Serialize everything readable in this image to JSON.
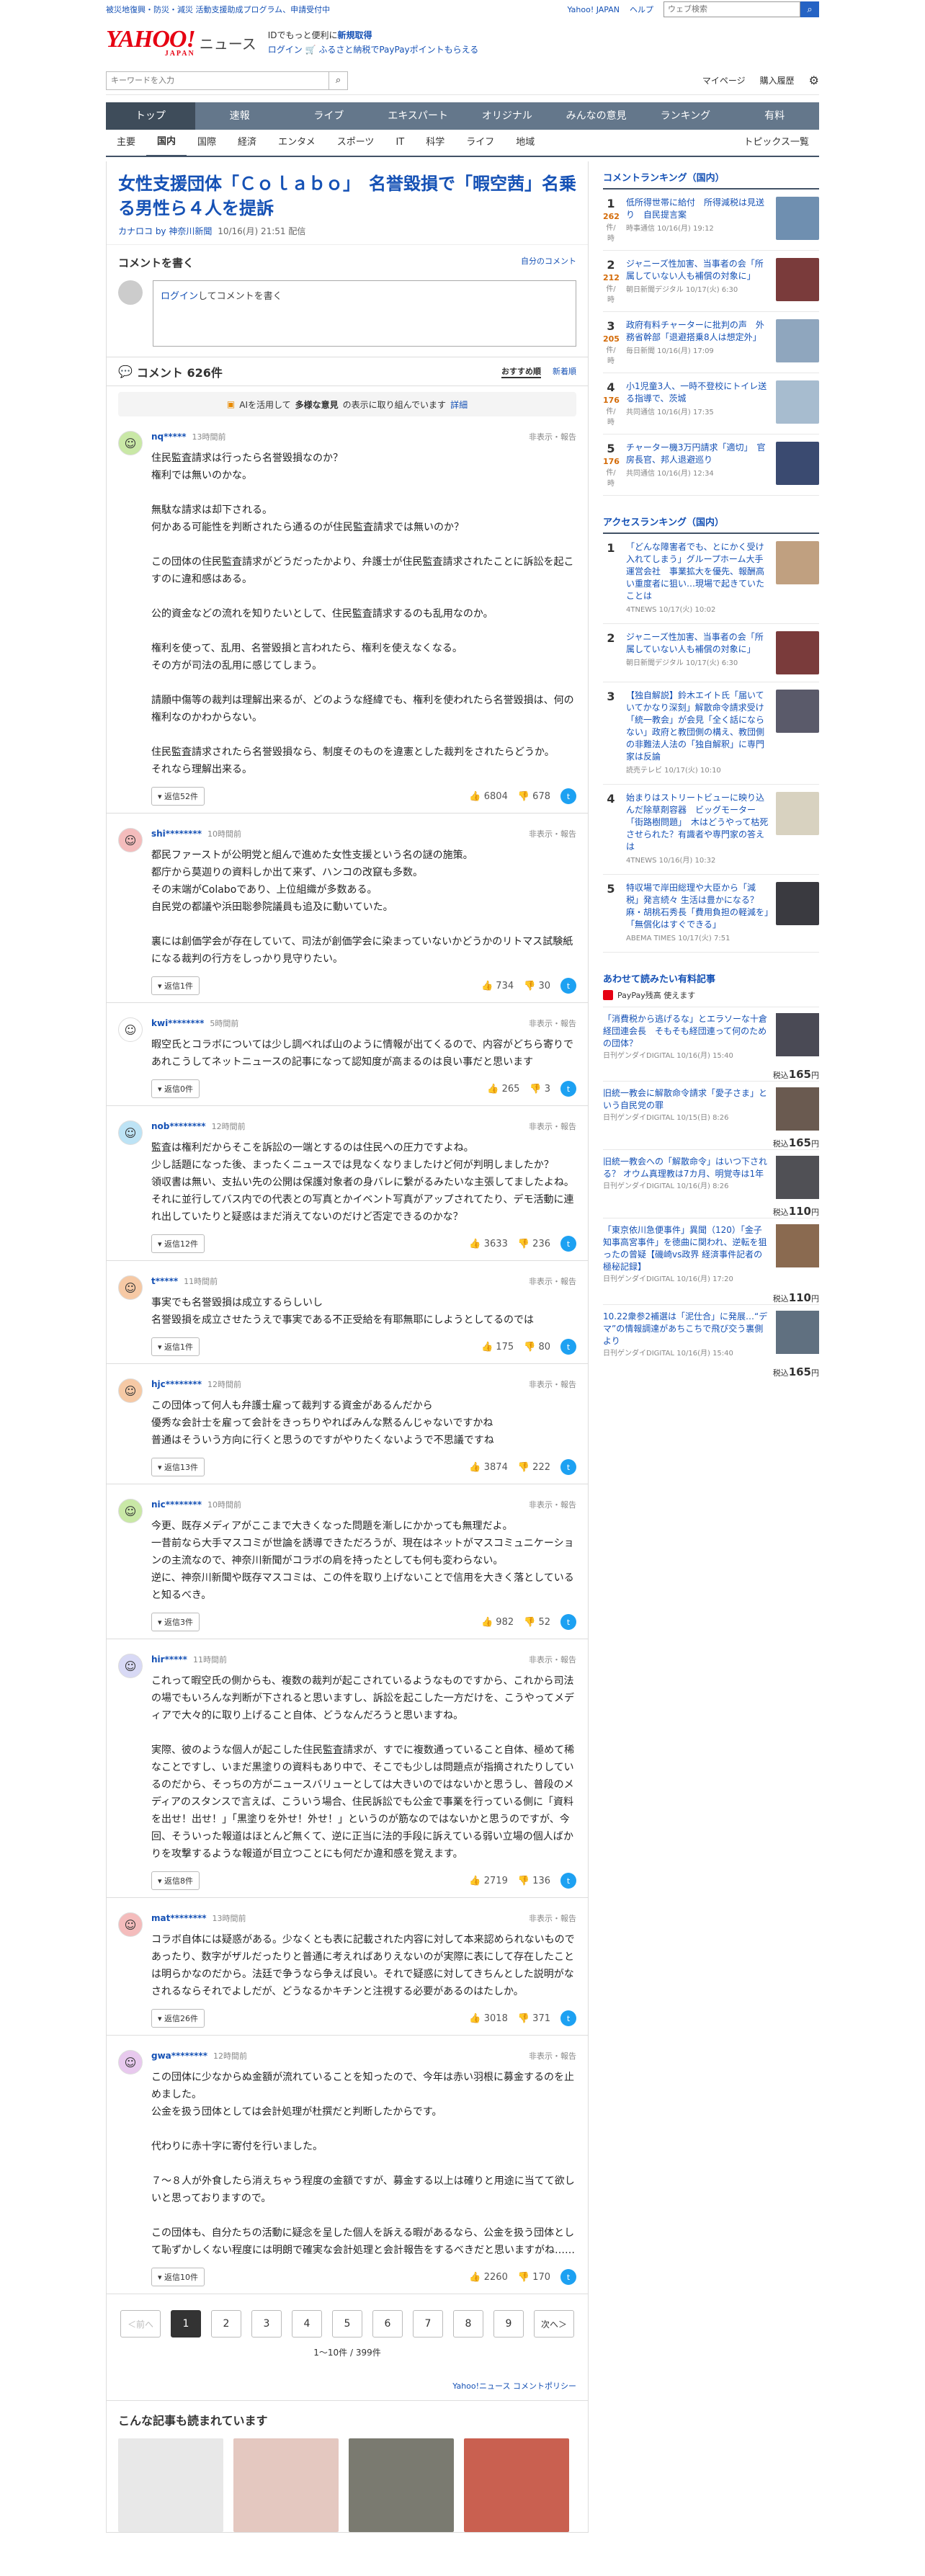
{
  "promo": {
    "text": "被災地復興・防災・減災 活動支援助成プログラム、申請受付中",
    "links": [
      "Yahoo! JAPAN",
      "ヘルプ"
    ],
    "search_placeholder": "ウェブ検索"
  },
  "brand": {
    "logo": "YAHOO!",
    "logo_sub": "JAPAN",
    "section": "ニュース",
    "msg1a": "IDでもっと便利に",
    "msg1b": "新規取得",
    "msg2a": "ログイン",
    "msg2b": "ふるさと納税でPayPayポイントもらえる"
  },
  "tools": {
    "search_placeholder": "キーワードを入力",
    "mypage": "マイページ",
    "purchase": "購入履歴"
  },
  "gnav": [
    "トップ",
    "速報",
    "ライブ",
    "エキスパート",
    "オリジナル",
    "みんなの意見",
    "ランキング",
    "有料"
  ],
  "subnav": [
    "主要",
    "国内",
    "国際",
    "経済",
    "エンタメ",
    "スポーツ",
    "IT",
    "科学",
    "ライフ",
    "地域"
  ],
  "subnav_right": "トピックス一覧",
  "article": {
    "title": "女性支援団体「Ｃｏｌａｂｏ」　名誉毀損で「暇空茜」名乗る男性ら４人を提訴",
    "author": "カナロコ by 神奈川新聞",
    "date": "10/16(月) 21:51 配信"
  },
  "comment_write": {
    "title": "コメントを書く",
    "link": "自分のコメント",
    "login": "ログイン",
    "rest": "してコメントを書く"
  },
  "comments_header": {
    "count": "コメント 626件",
    "sort_rec": "おすすめ順",
    "sort_new": "新着順"
  },
  "ai_bar": {
    "pre": "AIを活用して",
    "bold": "多様な意見",
    "post": "の表示に取り組んでいます",
    "link": "詳細"
  },
  "comments": [
    {
      "user": "nq*****",
      "time": "13時間前",
      "report": "非表示・報告",
      "text": "住民監査請求は行ったら名誉毀損なのか？\n権利では無いのかな。\n\n無駄な請求は却下される。\n何かある可能性を判断されたら通るのが住民監査請求では無いのか？\n\nこの団体の住民監査請求がどうだったかより、弁護士が住民監査請求されたことに訴訟を起こすのに違和感はある。\n\n公的資金などの流れを知りたいとして、住民監査請求するのも乱用なのか。\n\n権利を使って、乱用、名誉毀損と言われたら、権利を使えなくなる。\nその方が司法の乱用に感じてしまう。\n\n請願中傷等の裁判は理解出来るが、どのような経緯でも、権利を使われたら名誉毀損は、何の権利なのかわからない。\n\n住民監査請求されたら名誉毀損なら、制度そのものを違憲とした裁判をされたらどうか。\nそれなら理解出来る。",
      "reply": "返信52件",
      "up": "6804",
      "down": "678",
      "color": "#c9e8a6"
    },
    {
      "user": "shi********",
      "time": "10時間前",
      "report": "非表示・報告",
      "text": "都民ファーストが公明党と組んで進めた女性支援という名の謎の施策。\n都庁から莫迦りの資料しか出て来ず、ハンコの改竄も多数。\nその末端がColaboであり、上位組織が多数ある。\n自民党の都議や浜田聡参院議員も追及に動いていた。\n\n裏には創価学会が存在していて、司法が創価学会に染まっていないかどうかのリトマス試験紙になる裁判の行方をしっかり見守りたい。",
      "reply": "返信1件",
      "up": "734",
      "down": "30",
      "color": "#f4bcbc"
    },
    {
      "user": "kwi********",
      "time": "5時間前",
      "report": "非表示・報告",
      "text": "暇空氏とコラボについては少し調べれば山のように情報が出てくるので、内容がどちら寄りであれこうしてネットニュースの記事になって認知度が高まるのは良い事だと思います",
      "reply": "返信0件",
      "up": "265",
      "down": "3",
      "color": "#ffffff"
    },
    {
      "user": "nob********",
      "time": "12時間前",
      "report": "非表示・報告",
      "text": "監査は権利だからそこを訴訟の一端とするのは住民への圧力ですよね。\n少し話題になった後、まったくニュースでは見なくなりましたけど何が判明しましたか？\n領収書は無い、支払い先の公開は保護対象者の身バレに繋がるみたいな主張してましたよね。\nそれに並行してバス内での代表との写真とかイベント写真がアップされてたり、デモ活動に連れ出していたりと疑惑はまだ消えてないのだけど否定できるのかな？",
      "reply": "返信12件",
      "up": "3633",
      "down": "236",
      "color": "#bde3f5"
    },
    {
      "user": "t*****",
      "time": "11時間前",
      "report": "非表示・報告",
      "text": "事実でも名誉毀損は成立するらしいし\n名誉毀損を成立させたうえで事実である不正受給を有耶無耶にしようとしてるのでは",
      "reply": "返信1件",
      "up": "175",
      "down": "80",
      "color": "#f6c9a5"
    },
    {
      "user": "hjc********",
      "time": "12時間前",
      "report": "非表示・報告",
      "text": "この団体って何人も弁護士雇って裁判する資金があるんだから\n優秀な会計士を雇って会計をきっちりやればみんな黙るんじゃないですかね\n普通はそういう方向に行くと思うのですがやりたくないようで不思議ですね",
      "reply": "返信13件",
      "up": "3874",
      "down": "222",
      "color": "#f6c9a5"
    },
    {
      "user": "nic********",
      "time": "10時間前",
      "report": "非表示・報告",
      "text": "今更、既存メディアがここまで大きくなった問題を漸しにかかっても無理だよ。\n一昔前なら大手マスコミが世論を誘導できただろうが、現在はネットがマスコミュニケーションの主流なので、神奈川新聞がコラボの肩を持ったとしても何も変わらない。\n逆に、神奈川新聞や既存マスコミは、この件を取り上げないことで信用を大きく落としていると知るべき。",
      "reply": "返信3件",
      "up": "982",
      "down": "52",
      "color": "#c9e8a6"
    },
    {
      "user": "hir*****",
      "time": "11時間前",
      "report": "非表示・報告",
      "text": "これって暇空氏の側からも、複数の裁判が起こされているようなものですから、これから司法の場でもいろんな判断が下されると思いますし、訴訟を起こした一方だけを、こうやってメディアで大々的に取り上げること自体、どうなんだろうと思いますね。\n\n実際、彼のような個人が起こした住民監査請求が、すでに複数通っていること自体、極めて稀なことですし、いまだ黒塗りの資料もあり中で、そこでも少しは問題点が指摘されたりしているのだから、そっちの方がニュースバリューとしては大きいのではないかと思うし、普段のメディアのスタンスで言えば、こういう場合、住民訴訟でも公金で事業を行っている側に「資料を出せ！出せ！」「黒塗りを外せ！外せ！」というのが筋なのではないかと思うのですが、今回、そういった報道はほとんど無くて、逆に正当に法的手段に訴えている弱い立場の個人ばかりを攻撃するような報道が目立つことにも何だか違和感を覚えます。",
      "reply": "返信8件",
      "up": "2719",
      "down": "136",
      "color": "#d8d9f5"
    },
    {
      "user": "mat********",
      "time": "13時間前",
      "report": "非表示・報告",
      "text": "コラボ自体には疑惑がある。少なくとも表に記載された内容に対して本来認められないものであったり、数字がザルだったりと普通に考えればありえないのが実際に表にして存在したことは明らかなのだから。法廷で争うなら争えば良い。それで疑惑に対してきちんとした説明がなされるならそれでよしだが、どうなるかキチンと注視する必要があるのはたしか。",
      "reply": "返信26件",
      "up": "3018",
      "down": "371",
      "color": "#f4bcbc"
    },
    {
      "user": "gwa********",
      "time": "12時間前",
      "report": "非表示・報告",
      "text": "この団体に少なからぬ金額が流れていることを知ったので、今年は赤い羽根に募金するのを止めました。\n公金を扱う団体としては会計処理が杜撰だと判断したからです。\n\n代わりに赤十字に寄付を行いました。\n\n７～８人が外食したら消えちゃう程度の金額ですが、募金する以上は確りと用途に当てて欲しいと思っておりますので。\n\nこの団体も、自分たちの活動に疑念を呈した個人を訴える暇があるなら、公金を扱う団体として恥ずかしくない程度には明朗で確実な会計処理と会計報告をするべきだと思いますがね……",
      "reply": "返信10件",
      "up": "2260",
      "down": "170",
      "color": "#e8c9ee"
    }
  ],
  "pager": {
    "prev": "＜前へ",
    "next": "次へ＞",
    "pages": [
      "1",
      "2",
      "3",
      "4",
      "5",
      "6",
      "7",
      "8",
      "9"
    ],
    "info": "1～10件 / 399件"
  },
  "policy": "Yahoo!ニュース コメントポリシー",
  "more_articles": "こんな記事も読まれています",
  "side": {
    "comment_rank_title": "コメントランキング（国内）",
    "comment_rank": [
      {
        "n": "1",
        "count": "262",
        "unit": "件/時",
        "title": "低所得世帯に給付　所得減税は見送り　自民提言案",
        "src": "時事通信 10/16(月) 19:12",
        "color": "#6f8fb0"
      },
      {
        "n": "2",
        "count": "212",
        "unit": "件/時",
        "title": "ジャニーズ性加害、当事者の会「所属していない人も補償の対象に」",
        "src": "朝日新聞デジタル 10/17(火) 6:30",
        "color": "#7a3b3b"
      },
      {
        "n": "3",
        "count": "205",
        "unit": "件/時",
        "title": "政府有料チャーターに批判の声　外務省幹部「退避搭乗8人は想定外」",
        "src": "毎日新聞 10/16(月) 17:09",
        "color": "#8fa6be"
      },
      {
        "n": "4",
        "count": "176",
        "unit": "件/時",
        "title": "小1児童3人、一時不登校にトイレ送る指導で、茨城",
        "src": "共同通信 10/16(月) 17:35",
        "color": "#a7bccf"
      },
      {
        "n": "5",
        "count": "176",
        "unit": "件/時",
        "title": "チャーター機3万円請求「適切」　官房長官、邦人退避巡り",
        "src": "共同通信 10/16(月) 12:34",
        "color": "#3a4a70"
      }
    ],
    "access_rank_title": "アクセスランキング（国内）",
    "access_rank": [
      {
        "n": "1",
        "title": "「どんな障害者でも、とにかく受け入れてしまう」グループホーム大手運営会社　事業拡大を優先、報酬高い重度者に狙い…現場で起きていたことは",
        "src": "4TNEWS 10/17(火) 10:02",
        "color": "#c0a080"
      },
      {
        "n": "2",
        "title": "ジャニーズ性加害、当事者の会「所属していない人も補償の対象に」",
        "src": "朝日新聞デジタル 10/17(火) 6:30",
        "color": "#7a3b3b"
      },
      {
        "n": "3",
        "title": "【独自解説】鈴木エイト氏「届いていてかなり深刻」解散命令請求受け「統一教会」が会見「全く話にならない」政府と教団側の構え、教団側の非難法人法の「独自解釈」に専門家は反論",
        "src": "読売テレビ 10/17(火) 10:10",
        "color": "#5a5a6a"
      },
      {
        "n": "4",
        "title": "始まりはストリートビューに映り込んだ除草剤容器　ビッグモーター「街路樹問題」　木はどうやって枯死させられた？有識者や専門家の答えは",
        "src": "4TNEWS 10/16(月) 10:32",
        "color": "#d8d2c0"
      },
      {
        "n": "5",
        "title": "特収場で岸田総理や大臣から「減税」発言続々 生活は豊かになる？ 麻・胡桃石秀長「費用負担の軽減を」「無償化はすぐできる」",
        "src": "ABEMA TIMES 10/17(火) 7:51",
        "color": "#3a3a40"
      }
    ],
    "ad_title": "あわせて読みたい有料記事",
    "ad_pp": "PayPay残高 使えます",
    "ad_items": [
      {
        "title": "「消費税から逃げるな」とエラソーな十倉経団連会長　そもそも経団連って何のための団体？",
        "src": "日刊ゲンダイDIGITAL 10/16(月) 15:40",
        "tax": "税込",
        "price": "165",
        "unit": "円",
        "color": "#4a4a55"
      },
      {
        "title": "旧統一教会に解散命令請求「愛子さま」という自民党の罪",
        "src": "日刊ゲンダイDIGITAL 10/15(日) 8:26",
        "tax": "税込",
        "price": "165",
        "unit": "円",
        "color": "#6a5a50"
      },
      {
        "title": "旧統一教会への「解散命令」はいつ下される？ オウム真理教は7カ月、明覚寺は1年",
        "src": "日刊ゲンダイDIGITAL 10/16(月) 8:26",
        "tax": "税込",
        "price": "110",
        "unit": "円",
        "color": "#505055"
      },
      {
        "title": "「東京依川急便事件」異聞（120）「金子知事高宮事件」を徳曲に関われ、逆転を狙ったの曾疑【磯崎vs政界 経済事件記者の極秘記録】",
        "src": "日刊ゲンダイDIGITAL 10/16(月) 17:20",
        "tax": "税込",
        "price": "110",
        "unit": "円",
        "color": "#8a6a50"
      },
      {
        "title": "10.22衆参2補選は「泥仕合」に発展…“デマ”の情報調達があちこちで飛び交う裏側より",
        "src": "日刊ゲンダイDIGITAL 10/16(月) 15:40",
        "tax": "税込",
        "price": "165",
        "unit": "円",
        "color": "#607080"
      }
    ]
  },
  "thumb_colors": [
    "#e8e8e8",
    "#e4c8c0",
    "#7a7a70",
    "#c96050"
  ]
}
